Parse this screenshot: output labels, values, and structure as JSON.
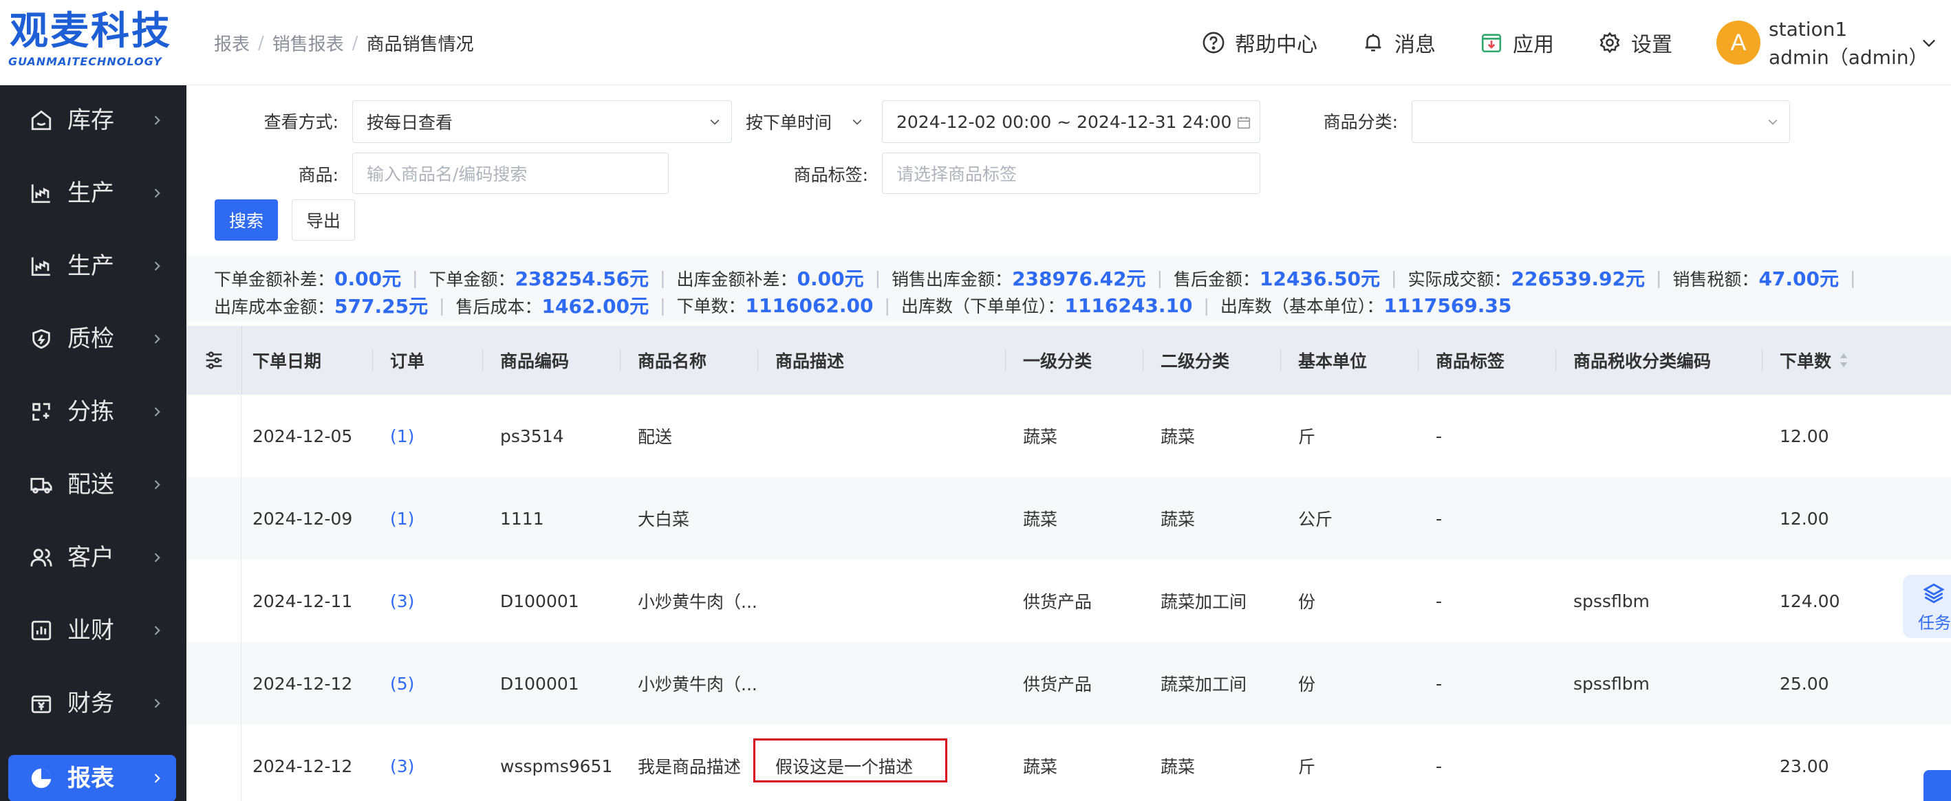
{
  "logo": {
    "main": "观麦科技",
    "sub": "GUANMAITECHNOLOGY",
    "color": "#1f5fd6"
  },
  "sidebar": {
    "items": [
      {
        "label": "库存",
        "icon": "home-icon"
      },
      {
        "label": "生产",
        "icon": "factory-icon"
      },
      {
        "label": "生产",
        "icon": "factory-icon"
      },
      {
        "label": "质检",
        "icon": "shield-check-icon"
      },
      {
        "label": "分拣",
        "icon": "sort-icon"
      },
      {
        "label": "配送",
        "icon": "truck-icon"
      },
      {
        "label": "客户",
        "icon": "users-icon"
      },
      {
        "label": "业财",
        "icon": "bar-chart-icon"
      },
      {
        "label": "财务",
        "icon": "yen-icon"
      },
      {
        "label": "报表",
        "icon": "pie-chart-icon",
        "active": true
      }
    ]
  },
  "breadcrumb": {
    "items": [
      "报表",
      "销售报表"
    ],
    "current": "商品销售情况"
  },
  "header": {
    "help": "帮助中心",
    "messages": "消息",
    "apps": "应用",
    "settings": "设置",
    "avatar_letter": "A",
    "user_station": "station1",
    "user_name": "admin（admin）"
  },
  "filters": {
    "view_mode_label": "查看方式:",
    "view_mode_value": "按每日查看",
    "time_type_value": "按下单时间",
    "date_range_value": "2024-12-02 00:00 ~ 2024-12-31 24:00",
    "category_label": "商品分类:",
    "category_value": "",
    "product_label": "商品:",
    "product_placeholder": "输入商品名/编码搜索",
    "tag_label": "商品标签:",
    "tag_placeholder": "请选择商品标签",
    "search_button": "搜索",
    "export_button": "导出"
  },
  "summary": {
    "row1": [
      {
        "label": "下单金额补差：",
        "value": "0.00元"
      },
      {
        "label": "下单金额：",
        "value": "238254.56元"
      },
      {
        "label": "出库金额补差：",
        "value": "0.00元"
      },
      {
        "label": "销售出库金额：",
        "value": "238976.42元"
      },
      {
        "label": "售后金额：",
        "value": "12436.50元"
      },
      {
        "label": "实际成交额：",
        "value": "226539.92元"
      },
      {
        "label": "销售税额：",
        "value": "47.00元"
      }
    ],
    "row2": [
      {
        "label": "出库成本金额：",
        "value": "577.25元"
      },
      {
        "label": "售后成本：",
        "value": "1462.00元"
      },
      {
        "label": "下单数：",
        "value": "1116062.00"
      },
      {
        "label": "出库数（下单单位）：",
        "value": "1116243.10"
      },
      {
        "label": "出库数（基本单位）：",
        "value": "1117569.35"
      }
    ]
  },
  "table": {
    "columns": [
      "下单日期",
      "订单",
      "商品编码",
      "商品名称",
      "商品描述",
      "一级分类",
      "二级分类",
      "基本单位",
      "商品标签",
      "商品税收分类编码",
      "下单数"
    ],
    "rows": [
      {
        "date": "2024-12-05",
        "order": "(1)",
        "code": "ps3514",
        "name": "配送",
        "desc": "",
        "cat1": "蔬菜",
        "cat2": "蔬菜",
        "unit": "斤",
        "tag": "-",
        "tax": "",
        "qty": "12.00"
      },
      {
        "date": "2024-12-09",
        "order": "(1)",
        "code": "1111",
        "name": "大白菜",
        "desc": "",
        "cat1": "蔬菜",
        "cat2": "蔬菜",
        "unit": "公斤",
        "tag": "-",
        "tax": "",
        "qty": "12.00"
      },
      {
        "date": "2024-12-11",
        "order": "(3)",
        "code": "D100001",
        "name": "小炒黄牛肉（...",
        "desc": "",
        "cat1": "供货产品",
        "cat2": "蔬菜加工间",
        "unit": "份",
        "tag": "-",
        "tax": "spssflbm",
        "qty": "124.00"
      },
      {
        "date": "2024-12-12",
        "order": "(5)",
        "code": "D100001",
        "name": "小炒黄牛肉（...",
        "desc": "",
        "cat1": "供货产品",
        "cat2": "蔬菜加工间",
        "unit": "份",
        "tag": "-",
        "tax": "spssflbm",
        "qty": "25.00"
      },
      {
        "date": "2024-12-12",
        "order": "(3)",
        "code": "wsspms9651",
        "name": "我是商品描述",
        "desc": "假设这是一个描述",
        "cat1": "蔬菜",
        "cat2": "蔬菜",
        "unit": "斤",
        "tag": "-",
        "tax": "",
        "qty": "23.00"
      }
    ]
  },
  "float_task": {
    "label": "任务"
  },
  "colors": {
    "primary": "#2f6bf2",
    "sidebar_bg": "#1f2329",
    "highlight": "#d9001b",
    "avatar": "#f5a623"
  }
}
